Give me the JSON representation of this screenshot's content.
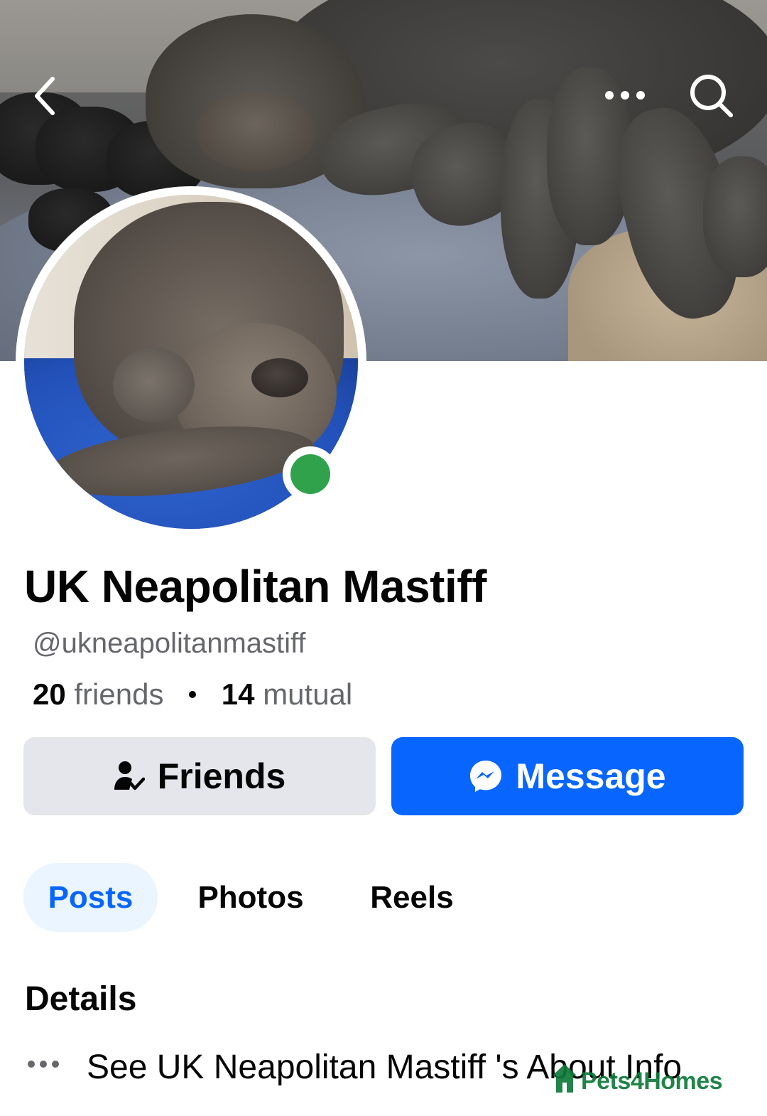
{
  "profile": {
    "name": "UK Neapolitan Mastiff",
    "username": "@ukneapolitanmastiff",
    "friends_count": "20",
    "friends_label": "friends",
    "mutual_count": "14",
    "mutual_label": "mutual",
    "online_status_color": "#31a24c"
  },
  "header": {
    "back_icon": "chevron-left-icon",
    "more_icon": "more-horizontal-icon",
    "search_icon": "search-icon"
  },
  "actions": {
    "friends_label": "Friends",
    "friends_icon": "person-check-icon",
    "message_label": "Message",
    "message_icon": "messenger-icon",
    "message_color": "#0866ff"
  },
  "tabs": [
    {
      "label": "Posts",
      "active": true
    },
    {
      "label": "Photos",
      "active": false
    },
    {
      "label": "Reels",
      "active": false
    }
  ],
  "details": {
    "heading": "Details",
    "about_link": "See UK Neapolitan Mastiff 's About Info"
  },
  "watermark": {
    "text": "Pets4Homes",
    "color": "#0f7a3a"
  }
}
